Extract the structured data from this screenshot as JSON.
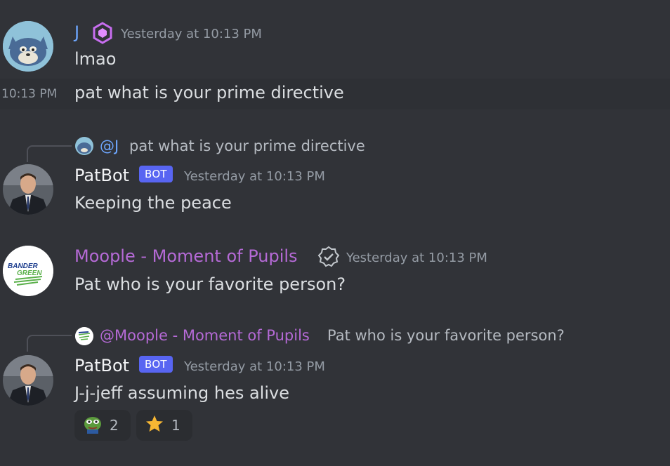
{
  "colors": {
    "bg": "#313338",
    "bot_tag": "#5865f2",
    "moople": "#b56ad6",
    "j": "#6ea7ff"
  },
  "messages": [
    {
      "author": "J",
      "timestamp": "Yesterday at 10:13 PM",
      "lines": [
        "lmao"
      ],
      "badge_icon": "nitro-gem-icon"
    },
    {
      "compact_time": "10:13 PM",
      "text": "pat what is your prime directive"
    },
    {
      "reply": {
        "mention": "@J",
        "text": "pat what is your prime directive"
      },
      "author": "PatBot",
      "bot_tag": "BOT",
      "timestamp": "Yesterday at 10:13 PM",
      "text": "Keeping the peace"
    },
    {
      "author": "Moople - Moment of Pupils",
      "badge_icon": "verified-badge-icon",
      "timestamp": "Yesterday at 10:13 PM",
      "text": "Pat who is your favorite person?",
      "avatar_text": "BANDER GREEN"
    },
    {
      "reply": {
        "mention": "@Moople - Moment of Pupils",
        "text": "Pat who is your favorite person?"
      },
      "author": "PatBot",
      "bot_tag": "BOT",
      "timestamp": "Yesterday at 10:13 PM",
      "text": "J-j-jeff assuming hes alive",
      "reactions": [
        {
          "emoji": "pepe-emoji",
          "count": "2"
        },
        {
          "emoji": "star-emoji",
          "count": "1"
        }
      ]
    }
  ]
}
